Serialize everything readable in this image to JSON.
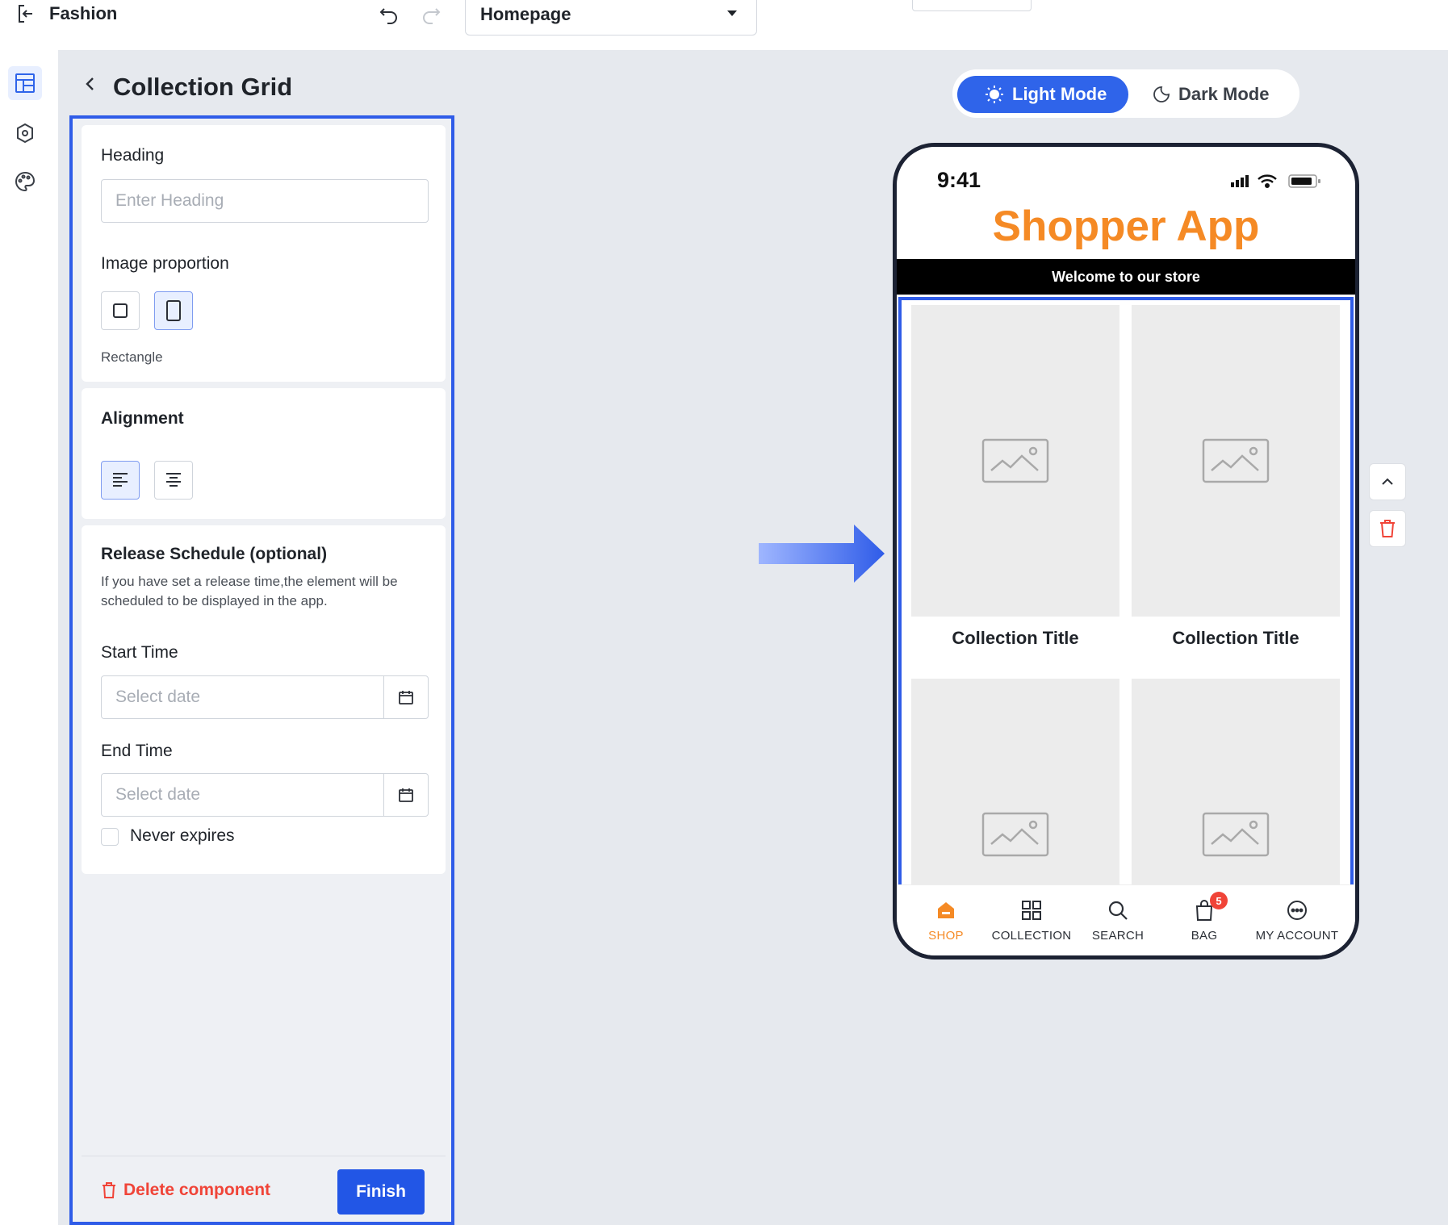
{
  "topbar": {
    "title": "Fashion",
    "page_selector": "Homepage"
  },
  "panel": {
    "title": "Collection Grid",
    "heading": {
      "label": "Heading",
      "placeholder": "Enter Heading",
      "value": ""
    },
    "image_proportion": {
      "label": "Image proportion",
      "options": [
        "square",
        "rectangle"
      ],
      "selected": "rectangle",
      "selected_label": "Rectangle"
    },
    "alignment": {
      "label": "Alignment",
      "options": [
        "left",
        "center"
      ],
      "selected": "left"
    },
    "release_schedule": {
      "title": "Release Schedule (optional)",
      "description": "If you have set a release time,the element will be scheduled to be displayed in the app.",
      "start_label": "Start Time",
      "start_placeholder": "Select date",
      "end_label": "End Time",
      "end_placeholder": "Select date",
      "never_expires_label": "Never expires",
      "never_expires_checked": false
    },
    "delete_label": "Delete component",
    "finish_label": "Finish"
  },
  "preview": {
    "light_mode_label": "Light Mode",
    "dark_mode_label": "Dark Mode",
    "active_mode": "light",
    "status_time": "9:41",
    "app_name": "Shopper App",
    "banner": "Welcome to our store",
    "tiles": [
      {
        "title": "Collection Title"
      },
      {
        "title": "Collection Title"
      },
      {
        "title": ""
      },
      {
        "title": ""
      }
    ],
    "tabs": [
      {
        "label": "SHOP",
        "icon": "home-icon",
        "active": true
      },
      {
        "label": "COLLECTION",
        "icon": "grid-icon",
        "active": false
      },
      {
        "label": "SEARCH",
        "icon": "search-icon",
        "active": false
      },
      {
        "label": "BAG",
        "icon": "bag-icon",
        "active": false,
        "badge": "5"
      },
      {
        "label": "MY ACCOUNT",
        "icon": "account-icon",
        "active": false
      }
    ]
  },
  "colors": {
    "accent": "#2f5ce8",
    "brand": "#f58a25",
    "danger": "#f04438"
  }
}
